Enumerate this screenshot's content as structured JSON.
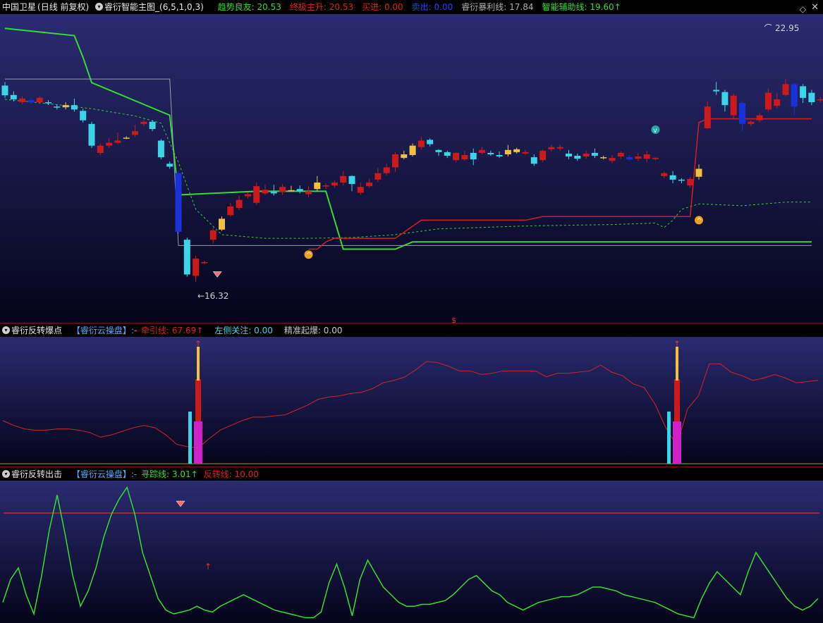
{
  "header": {
    "security": "中国卫星",
    "period": "(日线 前复权)",
    "indicator": "睿衍智能主图_(6,5,1,0,3)",
    "items": [
      {
        "label": "趋势良友:",
        "value": "20.53",
        "color": "#33dd33"
      },
      {
        "label": "终极主升:",
        "value": "20.53",
        "color": "#e02020"
      },
      {
        "label": "买进:",
        "value": "0.00",
        "color": "#e02020"
      },
      {
        "label": "卖出:",
        "value": "0.00",
        "color": "#2040ff"
      },
      {
        "label": "睿衍暴利线:",
        "value": "17.84",
        "color": "#b0b0b0"
      },
      {
        "label": "智能辅助线:",
        "value": "19.60↑",
        "color": "#33dd33"
      }
    ],
    "diamond_icon": "◇",
    "close_icon": "✕"
  },
  "main": {
    "high_label": "22.95",
    "low_label": "16.32",
    "dollar_mark": "$"
  },
  "sub1": {
    "title": "睿衍反转爆点",
    "tag": "【睿衍云操盘】:-",
    "items": [
      {
        "label": "牵引线:",
        "value": "67.69↑",
        "color": "#e02020"
      },
      {
        "label": "左侧关注:",
        "value": "0.00",
        "color": "#3ad6e8"
      },
      {
        "label": "精准起爆:",
        "value": "0.00",
        "color": "#c8c8c8"
      }
    ]
  },
  "sub2": {
    "title": "睿衍反转出击",
    "tag": "【睿衍云操盘】:-",
    "items": [
      {
        "label": "寻踪线:",
        "value": "3.01↑",
        "color": "#33dd33"
      },
      {
        "label": "反转线:",
        "value": "10.00",
        "color": "#e02020"
      }
    ]
  },
  "chart_data": [
    {
      "type": "candlestick",
      "title": "睿衍智能主图",
      "x": [
        0,
        1,
        2,
        3,
        4,
        5,
        6,
        7,
        8,
        9,
        10,
        11,
        12,
        13,
        14,
        15,
        16,
        17,
        18,
        19,
        20,
        21,
        22,
        23,
        24,
        25,
        26,
        27,
        28,
        29,
        30,
        31,
        32,
        33,
        34,
        35,
        36,
        37,
        38,
        39,
        40,
        41,
        42,
        43,
        44,
        45,
        46,
        47,
        48,
        49,
        50,
        51,
        52,
        53,
        54,
        55,
        56,
        57,
        58,
        59,
        60,
        61,
        62,
        63,
        64,
        65,
        66,
        67,
        68,
        69,
        70,
        71,
        72,
        73,
        74,
        75,
        76,
        77,
        78,
        79,
        80,
        81,
        82,
        83,
        84,
        85,
        86,
        87,
        88,
        89,
        90,
        91,
        92,
        93
      ],
      "candles": [
        [
          22.82,
          22.55,
          22.92,
          22.48
        ],
        [
          22.56,
          22.44,
          22.66,
          22.38
        ],
        [
          22.36,
          22.46,
          22.52,
          22.3
        ],
        [
          22.42,
          22.36,
          22.48,
          22.3
        ],
        [
          22.36,
          22.48,
          22.52,
          22.3
        ],
        [
          22.36,
          22.34,
          22.42,
          22.28
        ],
        [
          22.24,
          22.22,
          22.3,
          22.16
        ],
        [
          22.22,
          22.28,
          22.36,
          22.16
        ],
        [
          22.28,
          22.16,
          22.46,
          22.1
        ],
        [
          22.12,
          21.86,
          22.18,
          21.8
        ],
        [
          21.76,
          21.16,
          21.82,
          21.1
        ],
        [
          20.96,
          21.16,
          21.22,
          20.9
        ],
        [
          21.16,
          21.24,
          21.36,
          21.1
        ],
        [
          21.24,
          21.3,
          21.52,
          21.2
        ],
        [
          21.36,
          21.38,
          21.42,
          21.34
        ],
        [
          21.46,
          21.56,
          21.74,
          21.4
        ],
        [
          21.76,
          21.82,
          21.88,
          21.7
        ],
        [
          21.82,
          21.62,
          21.86,
          21.56
        ],
        [
          21.3,
          20.84,
          21.34,
          20.78
        ],
        [
          20.66,
          20.58,
          20.72,
          20.52
        ],
        [
          20.4,
          18.78,
          20.46,
          18.72
        ],
        [
          18.56,
          17.6,
          18.62,
          17.54
        ],
        [
          17.56,
          18.04,
          18.12,
          17.4
        ],
        [
          17.92,
          17.94,
          17.98,
          17.88
        ],
        [
          18.56,
          18.82,
          18.9,
          18.46
        ],
        [
          18.84,
          19.14,
          19.2,
          18.8
        ],
        [
          19.24,
          19.48,
          19.58,
          19.2
        ],
        [
          19.44,
          19.66,
          19.78,
          19.38
        ],
        [
          19.76,
          19.82,
          19.88,
          19.7
        ],
        [
          19.58,
          20.04,
          20.14,
          19.52
        ],
        [
          19.84,
          19.94,
          20.08,
          19.8
        ],
        [
          19.88,
          19.84,
          20.08,
          19.78
        ],
        [
          19.88,
          20.02,
          20.1,
          19.8
        ],
        [
          19.93,
          19.93,
          20.05,
          19.88
        ],
        [
          19.96,
          19.9,
          20.06,
          19.84
        ],
        [
          19.82,
          19.9,
          20.04,
          19.74
        ],
        [
          19.96,
          20.14,
          20.32,
          19.9
        ],
        [
          20.04,
          20.06,
          20.12,
          19.96
        ],
        [
          20.06,
          20.14,
          20.2,
          20.0
        ],
        [
          20.14,
          20.32,
          20.46,
          20.06
        ],
        [
          20.32,
          20.1,
          20.34,
          19.9
        ],
        [
          19.86,
          20.02,
          20.14,
          19.8
        ],
        [
          20.04,
          20.14,
          20.24,
          20.0
        ],
        [
          20.22,
          20.4,
          20.54,
          20.16
        ],
        [
          20.4,
          20.56,
          20.66,
          20.34
        ],
        [
          20.56,
          20.92,
          20.98,
          20.44
        ],
        [
          20.82,
          20.92,
          21.02,
          20.78
        ],
        [
          20.9,
          21.16,
          21.22,
          20.86
        ],
        [
          21.12,
          21.3,
          21.4,
          21.06
        ],
        [
          21.32,
          21.2,
          21.36,
          21.14
        ],
        [
          21.04,
          20.98,
          21.06,
          20.88
        ],
        [
          20.98,
          20.88,
          21.02,
          20.82
        ],
        [
          20.76,
          20.96,
          20.98,
          20.7
        ],
        [
          20.78,
          20.9,
          21.02,
          20.74
        ],
        [
          20.96,
          20.78,
          21.08,
          20.62
        ],
        [
          20.96,
          21.04,
          21.12,
          20.92
        ],
        [
          20.96,
          20.92,
          21.02,
          20.88
        ],
        [
          20.9,
          20.86,
          21.0,
          20.82
        ],
        [
          20.92,
          21.04,
          21.18,
          20.86
        ],
        [
          20.98,
          21.06,
          21.1,
          20.94
        ],
        [
          20.94,
          20.98,
          21.04,
          20.9
        ],
        [
          20.84,
          20.66,
          20.92,
          20.6
        ],
        [
          20.76,
          21.02,
          21.06,
          20.7
        ],
        [
          21.06,
          21.12,
          21.18,
          21.0
        ],
        [
          21.08,
          21.12,
          21.18,
          21.02
        ],
        [
          20.94,
          20.86,
          21.04,
          20.78
        ],
        [
          20.88,
          20.8,
          20.94,
          20.74
        ],
        [
          20.86,
          20.94,
          21.02,
          20.8
        ],
        [
          20.96,
          20.88,
          21.08,
          20.82
        ],
        [
          20.82,
          20.84,
          20.88,
          20.78
        ],
        [
          20.74,
          20.82,
          20.9,
          20.68
        ],
        [
          20.86,
          20.96,
          21.0,
          20.8
        ],
        [
          20.84,
          20.78,
          20.9,
          20.74
        ],
        [
          20.8,
          20.86,
          20.96,
          20.74
        ],
        [
          20.8,
          20.92,
          21.0,
          20.7
        ],
        [
          20.8,
          20.82,
          20.84,
          20.76
        ],
        [
          20.32,
          20.4,
          20.46,
          20.26
        ],
        [
          20.34,
          20.22,
          20.46,
          20.12
        ],
        [
          20.22,
          20.2,
          20.26,
          20.12
        ],
        [
          20.06,
          20.24,
          20.3,
          20.0
        ],
        [
          20.3,
          20.52,
          20.64,
          20.22
        ],
        [
          21.64,
          22.24,
          22.38,
          21.62
        ],
        [
          22.7,
          22.66,
          22.92,
          22.56
        ],
        [
          22.64,
          22.28,
          22.7,
          22.1
        ],
        [
          22.0,
          22.54,
          22.6,
          21.9
        ],
        [
          22.34,
          21.76,
          22.38,
          21.58
        ],
        [
          21.76,
          21.82,
          21.86,
          21.7
        ],
        [
          21.86,
          22.0,
          22.06,
          21.8
        ],
        [
          22.16,
          22.62,
          22.74,
          22.1
        ],
        [
          22.26,
          22.44,
          22.6,
          22.2
        ],
        [
          22.56,
          22.86,
          23.0,
          22.52
        ],
        [
          22.86,
          22.24,
          22.9,
          22.0
        ],
        [
          22.8,
          22.48,
          22.86,
          22.34
        ],
        [
          22.62,
          22.36,
          22.7,
          22.28
        ],
        [
          22.42,
          22.44,
          22.5,
          22.36
        ],
        [
          22.3,
          22.46,
          22.56,
          22.26
        ]
      ],
      "series": [
        {
          "name": "趋势良友",
          "x": [
            0,
            8,
            9,
            10,
            19,
            20,
            29,
            33,
            34,
            36,
            37,
            39,
            45,
            47,
            60,
            70,
            75,
            76,
            77,
            79,
            80,
            81,
            82,
            83,
            93
          ],
          "y": [
            24.4,
            24.2,
            23.6,
            22.9,
            22.0,
            19.8,
            19.9,
            19.9,
            19.9,
            19.9,
            19.9,
            18.3,
            18.3,
            18.5,
            18.5,
            18.5,
            18.5,
            18.5,
            18.5,
            18.5,
            18.5,
            18.5,
            18.5,
            18.5,
            18.5
          ]
        },
        {
          "name": "睿衍暴利线",
          "x": [
            0,
            19,
            20,
            93
          ],
          "y": [
            23.0,
            23.0,
            18.4,
            18.4
          ]
        },
        {
          "name": "智能辅助线",
          "x": [
            0,
            5,
            10,
            15,
            18,
            20,
            22,
            25,
            30,
            35,
            40,
            45,
            50,
            55,
            60,
            65,
            70,
            75,
            76,
            77,
            78,
            80,
            85,
            90,
            93
          ],
          "y": [
            22.44,
            22.32,
            22.18,
            21.98,
            21.78,
            20.7,
            19.4,
            18.7,
            18.6,
            18.6,
            18.62,
            18.7,
            18.86,
            18.9,
            18.94,
            18.96,
            18.98,
            19.02,
            18.9,
            19.1,
            19.4,
            19.55,
            19.5,
            19.6,
            19.6
          ]
        }
      ],
      "annotations": [
        "22.95",
        "16.32",
        "$"
      ]
    },
    {
      "type": "line",
      "title": "睿衍反转爆点",
      "series": [
        {
          "name": "牵引线",
          "values": [
            34,
            30,
            27,
            26,
            26,
            27,
            27,
            26,
            24,
            20,
            22,
            25,
            28,
            30,
            28,
            22,
            14,
            12,
            11,
            19,
            26,
            30,
            34,
            37,
            37,
            38,
            39,
            43,
            47,
            52,
            54,
            55,
            57,
            58,
            61,
            66,
            68,
            71,
            77,
            84,
            83,
            80,
            76,
            76,
            73,
            74,
            76,
            76,
            76,
            76,
            71,
            74,
            74,
            75,
            76,
            81,
            75,
            72,
            65,
            62,
            48,
            28,
            13,
            44,
            55,
            82,
            82,
            75,
            72,
            68,
            70,
            73,
            70,
            66,
            67,
            68
          ]
        }
      ],
      "signals": [
        {
          "name": "爆点1",
          "value": 100
        },
        {
          "name": "爆点2",
          "value": 100
        }
      ]
    },
    {
      "type": "line",
      "title": "睿衍反转出击",
      "series": [
        {
          "name": "寻踪线",
          "values": [
            10,
            22,
            28,
            14,
            4,
            24,
            48,
            66,
            46,
            24,
            8,
            16,
            28,
            44,
            56,
            64,
            70,
            56,
            36,
            24,
            12,
            6,
            4,
            5,
            6,
            8,
            6,
            5,
            8,
            10,
            12,
            14,
            12,
            10,
            8,
            6,
            5,
            4,
            3,
            2,
            2,
            5,
            20,
            30,
            18,
            3,
            22,
            32,
            25,
            18,
            14,
            10,
            8,
            8,
            9,
            9,
            10,
            11,
            14,
            18,
            22,
            24,
            20,
            16,
            14,
            10,
            8,
            6,
            8,
            10,
            11,
            12,
            13,
            13,
            14,
            16,
            18,
            18,
            17,
            16,
            14,
            13,
            12,
            11,
            10,
            8,
            6,
            4,
            3,
            2,
            12,
            20,
            26,
            22,
            18,
            14,
            26,
            36,
            30,
            24,
            18,
            12,
            8,
            6,
            8,
            12
          ]
        },
        {
          "name": "反转线",
          "values": [
            10
          ]
        }
      ]
    }
  ]
}
